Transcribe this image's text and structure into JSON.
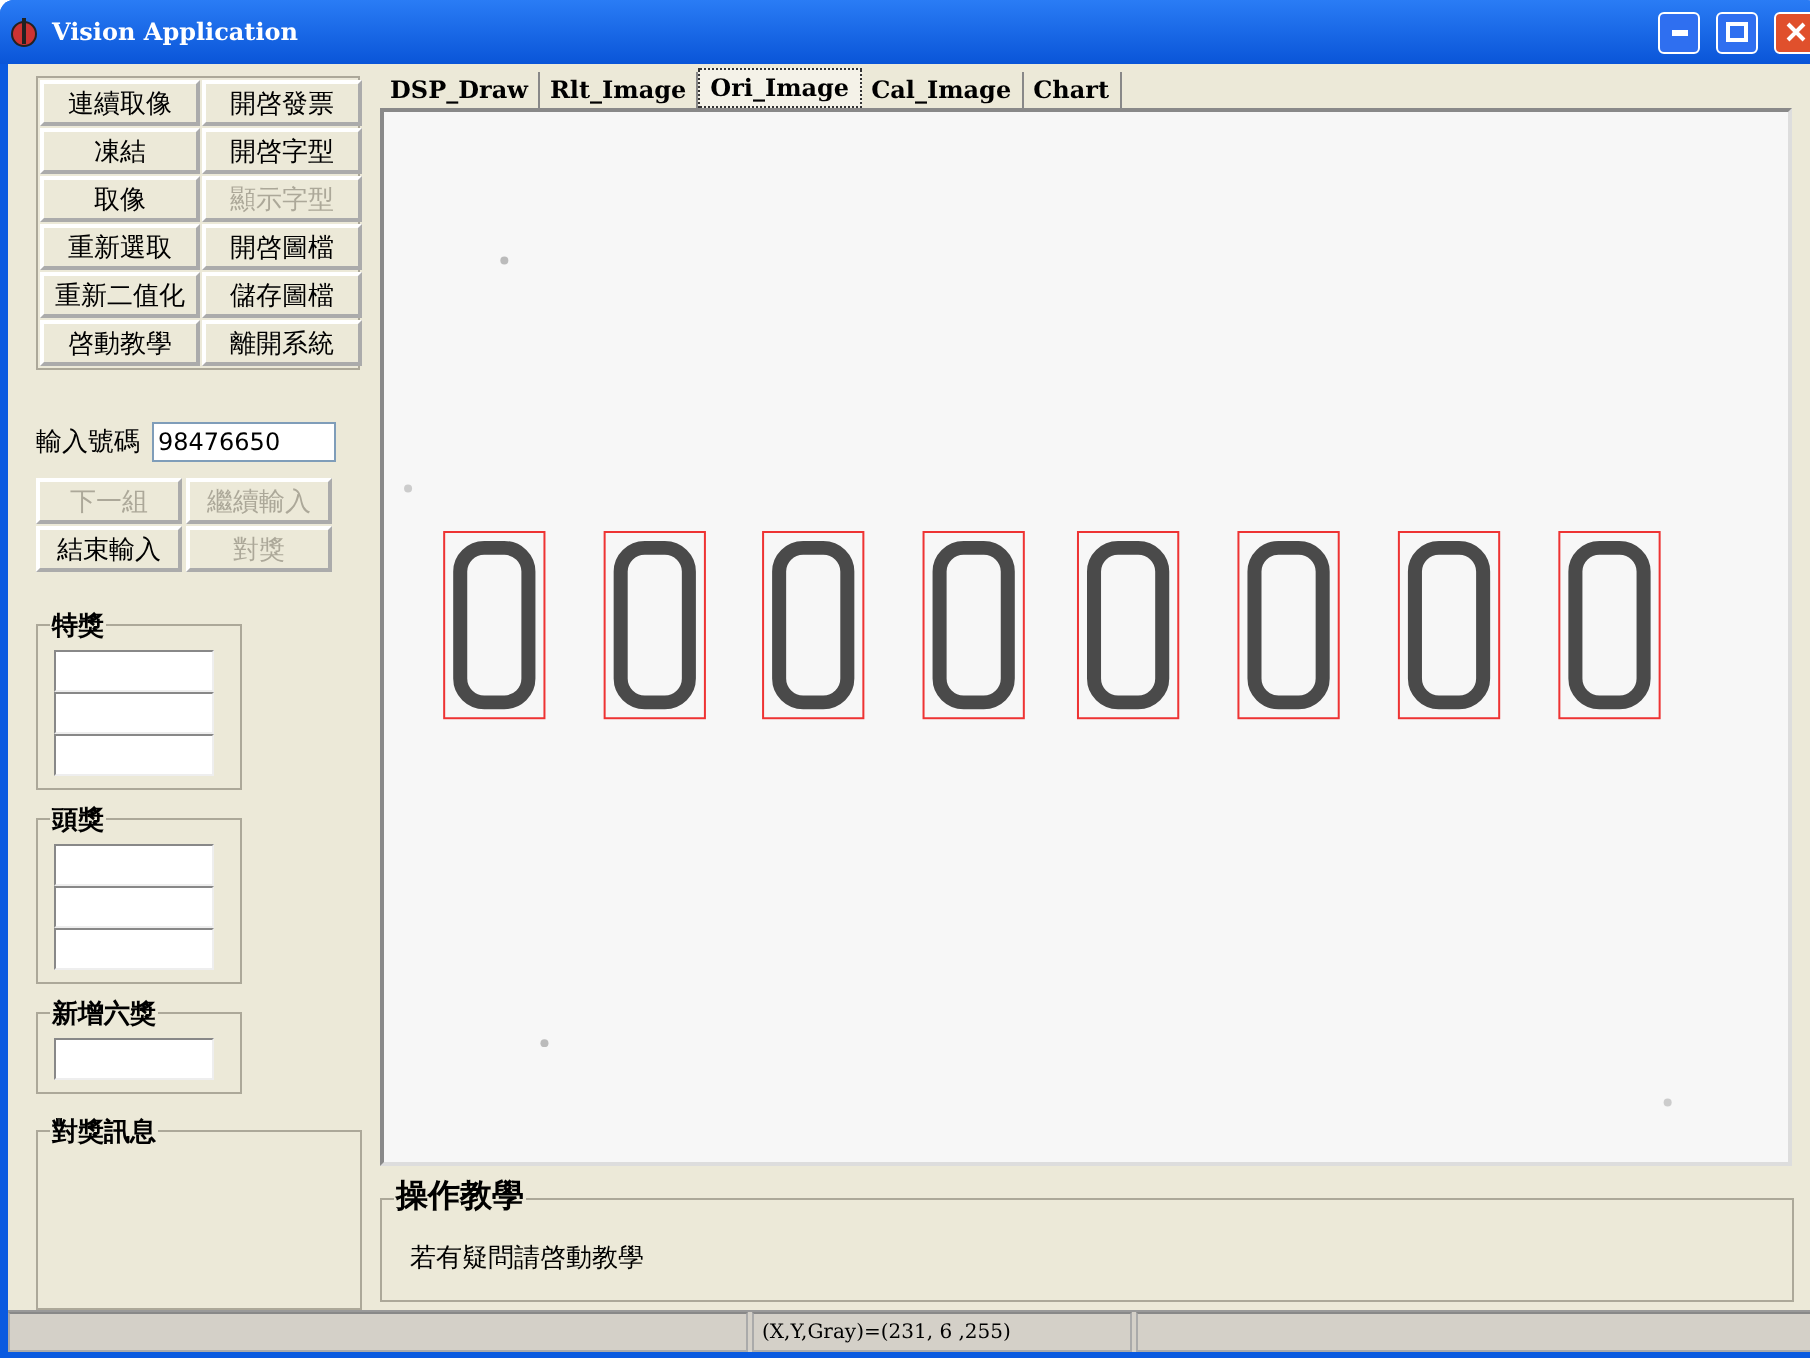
{
  "window": {
    "title": "Vision Application"
  },
  "buttons": [
    {
      "label": "連續取像",
      "disabled": false
    },
    {
      "label": "開啓發票",
      "disabled": false
    },
    {
      "label": "凍結",
      "disabled": false
    },
    {
      "label": "開啓字型",
      "disabled": false
    },
    {
      "label": "取像",
      "disabled": false
    },
    {
      "label": "顯示字型",
      "disabled": true
    },
    {
      "label": "重新選取",
      "disabled": false
    },
    {
      "label": "開啓圖檔",
      "disabled": false
    },
    {
      "label": "重新二值化",
      "disabled": false
    },
    {
      "label": "儲存圖檔",
      "disabled": false
    },
    {
      "label": "啓動教學",
      "disabled": false
    },
    {
      "label": "離開系統",
      "disabled": false
    }
  ],
  "number_input": {
    "label": "輸入號碼",
    "value": "98476650"
  },
  "input_buttons": [
    {
      "label": "下一組",
      "disabled": true
    },
    {
      "label": "繼續輸入",
      "disabled": true
    },
    {
      "label": "結束輸入",
      "disabled": false
    },
    {
      "label": "對獎",
      "disabled": true
    }
  ],
  "prize_groups": [
    {
      "title": "特獎",
      "fields": [
        {
          "kind": "text"
        },
        {
          "kind": "text"
        },
        {
          "kind": "text"
        }
      ]
    },
    {
      "title": "頭獎",
      "fields": [
        {
          "kind": "text"
        },
        {
          "kind": "text"
        },
        {
          "kind": "text"
        }
      ]
    },
    {
      "title": "新增六獎",
      "fields": [
        {
          "kind": "text"
        }
      ]
    }
  ],
  "message_group": {
    "title": "對獎訊息"
  },
  "tabs": [
    {
      "label": "DSP_Draw",
      "selected": false
    },
    {
      "label": "Rlt_Image",
      "selected": false
    },
    {
      "label": "Ori_Image",
      "selected": true
    },
    {
      "label": "Cal_Image",
      "selected": false
    },
    {
      "label": "Chart",
      "selected": false
    }
  ],
  "tutorial": {
    "title": "操作教學",
    "text": "若有疑問請啓動教學"
  },
  "status_bar": {
    "reading": "(X,Y,Gray)=(231, 6 ,255)"
  }
}
